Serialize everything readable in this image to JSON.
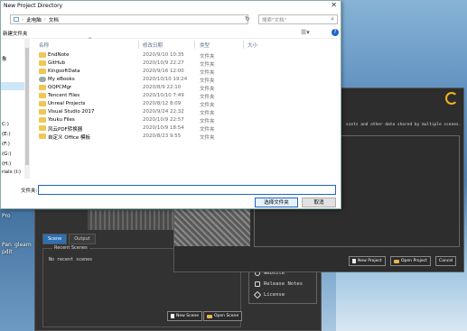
{
  "dialog": {
    "title": "New Project Directory",
    "close": "✕",
    "path": [
      "此电脑",
      "文档"
    ],
    "search_placeholder": "搜索\"文档\"",
    "new_folder": "新建文件夹",
    "columns": {
      "name": "名称",
      "date": "修改日期",
      "type": "类型",
      "size": "大小"
    },
    "nav_items": [
      "象",
      "C:)",
      "(E:)",
      "(F:)",
      "(G:)",
      "(H:)",
      "rials (I:)"
    ],
    "rows": [
      {
        "name": "EndNote",
        "date": "2020/9/10 10:35",
        "type": "文件夹"
      },
      {
        "name": "GitHub",
        "date": "2020/10/9 22:27",
        "type": "文件夹"
      },
      {
        "name": "KingsoftData",
        "date": "2020/9/16 12:00",
        "type": "文件夹"
      },
      {
        "name": "My eBooks",
        "date": "2020/10/10 19:24",
        "type": "文件夹"
      },
      {
        "name": "QQPCMgr",
        "date": "2020/8/9 22:10",
        "type": "文件夹"
      },
      {
        "name": "Tencent Files",
        "date": "2020/10/10 7:49",
        "type": "文件夹"
      },
      {
        "name": "Unreal Projects",
        "date": "2020/8/12 8:09",
        "type": "文件夹"
      },
      {
        "name": "Visual Studio 2017",
        "date": "2020/9/24 22:32",
        "type": "文件夹"
      },
      {
        "name": "Youku Files",
        "date": "2020/10/9 22:57",
        "type": "文件夹"
      },
      {
        "name": "风云PDF转换器",
        "date": "2020/10/9 18:54",
        "type": "文件夹"
      },
      {
        "name": "自定义 Office 模板",
        "date": "2020/8/23 9:55",
        "type": "文件夹"
      }
    ],
    "filename_label": "文件夹:",
    "filename_value": "",
    "ok_label": "选择文件夹",
    "cancel_label": "取消"
  },
  "back_app": {
    "tabs": [
      "Scene",
      "Output"
    ],
    "recent_legend": "Recent Scenes",
    "recent_empty": "No recent scenes",
    "new_scene": "New Scene",
    "open_scene": "Open Scene",
    "links": [
      "Website",
      "Release Notes",
      "License"
    ]
  },
  "front_app": {
    "description": "ssets and other data shared by multiple scenes.",
    "new_project": "New Project",
    "open_project": "Open Project",
    "cancel": "Cancel"
  },
  "desktop": {
    "labels": [
      "Pro",
      "Pan",
      "gleam",
      "pdit"
    ]
  },
  "colors": {
    "accent": "#1e66c6",
    "folder": "#f0c656",
    "logo": "#f2b21c"
  }
}
